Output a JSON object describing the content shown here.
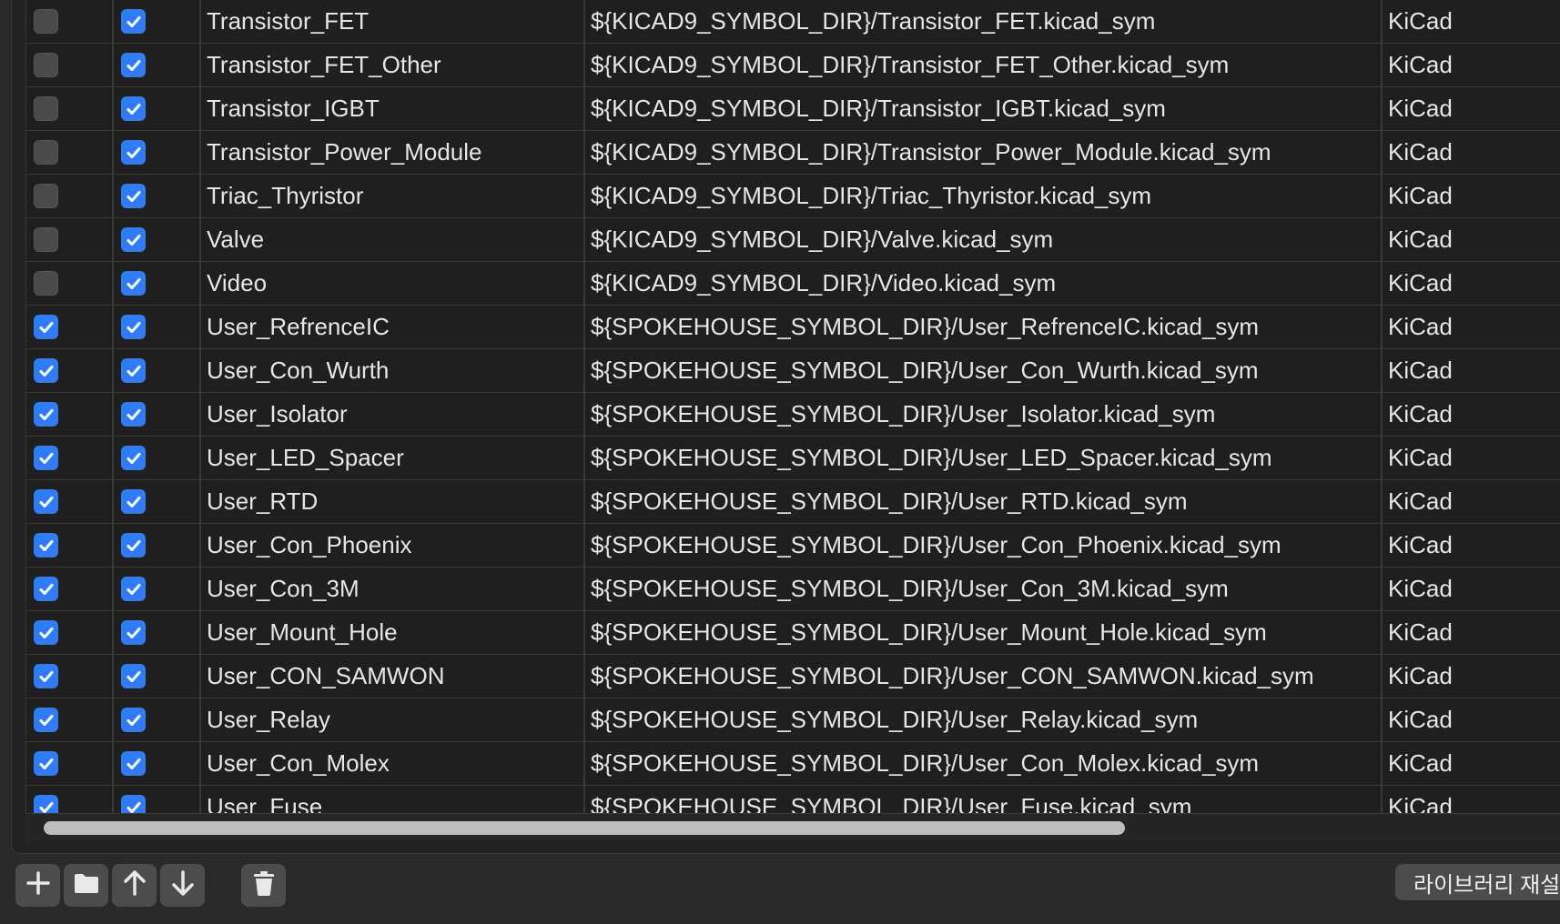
{
  "rows": [
    {
      "active": false,
      "visible": true,
      "nickname": "Transistor_FET",
      "path": "${KICAD9_SYMBOL_DIR}/Transistor_FET.kicad_sym",
      "type": "KiCad"
    },
    {
      "active": false,
      "visible": true,
      "nickname": "Transistor_FET_Other",
      "path": "${KICAD9_SYMBOL_DIR}/Transistor_FET_Other.kicad_sym",
      "type": "KiCad"
    },
    {
      "active": false,
      "visible": true,
      "nickname": "Transistor_IGBT",
      "path": "${KICAD9_SYMBOL_DIR}/Transistor_IGBT.kicad_sym",
      "type": "KiCad"
    },
    {
      "active": false,
      "visible": true,
      "nickname": "Transistor_Power_Module",
      "path": "${KICAD9_SYMBOL_DIR}/Transistor_Power_Module.kicad_sym",
      "type": "KiCad"
    },
    {
      "active": false,
      "visible": true,
      "nickname": "Triac_Thyristor",
      "path": "${KICAD9_SYMBOL_DIR}/Triac_Thyristor.kicad_sym",
      "type": "KiCad"
    },
    {
      "active": false,
      "visible": true,
      "nickname": "Valve",
      "path": "${KICAD9_SYMBOL_DIR}/Valve.kicad_sym",
      "type": "KiCad"
    },
    {
      "active": false,
      "visible": true,
      "nickname": "Video",
      "path": "${KICAD9_SYMBOL_DIR}/Video.kicad_sym",
      "type": "KiCad"
    },
    {
      "active": true,
      "visible": true,
      "nickname": "User_RefrenceIC",
      "path": "${SPOKEHOUSE_SYMBOL_DIR}/User_RefrenceIC.kicad_sym",
      "type": "KiCad"
    },
    {
      "active": true,
      "visible": true,
      "nickname": "User_Con_Wurth",
      "path": "${SPOKEHOUSE_SYMBOL_DIR}/User_Con_Wurth.kicad_sym",
      "type": "KiCad"
    },
    {
      "active": true,
      "visible": true,
      "nickname": "User_Isolator",
      "path": "${SPOKEHOUSE_SYMBOL_DIR}/User_Isolator.kicad_sym",
      "type": "KiCad"
    },
    {
      "active": true,
      "visible": true,
      "nickname": "User_LED_Spacer",
      "path": "${SPOKEHOUSE_SYMBOL_DIR}/User_LED_Spacer.kicad_sym",
      "type": "KiCad"
    },
    {
      "active": true,
      "visible": true,
      "nickname": "User_RTD",
      "path": "${SPOKEHOUSE_SYMBOL_DIR}/User_RTD.kicad_sym",
      "type": "KiCad"
    },
    {
      "active": true,
      "visible": true,
      "nickname": "User_Con_Phoenix",
      "path": "${SPOKEHOUSE_SYMBOL_DIR}/User_Con_Phoenix.kicad_sym",
      "type": "KiCad"
    },
    {
      "active": true,
      "visible": true,
      "nickname": "User_Con_3M",
      "path": "${SPOKEHOUSE_SYMBOL_DIR}/User_Con_3M.kicad_sym",
      "type": "KiCad"
    },
    {
      "active": true,
      "visible": true,
      "nickname": "User_Mount_Hole",
      "path": "${SPOKEHOUSE_SYMBOL_DIR}/User_Mount_Hole.kicad_sym",
      "type": "KiCad"
    },
    {
      "active": true,
      "visible": true,
      "nickname": "User_CON_SAMWON",
      "path": "${SPOKEHOUSE_SYMBOL_DIR}/User_CON_SAMWON.kicad_sym",
      "type": "KiCad"
    },
    {
      "active": true,
      "visible": true,
      "nickname": "User_Relay",
      "path": "${SPOKEHOUSE_SYMBOL_DIR}/User_Relay.kicad_sym",
      "type": "KiCad"
    },
    {
      "active": true,
      "visible": true,
      "nickname": "User_Con_Molex",
      "path": "${SPOKEHOUSE_SYMBOL_DIR}/User_Con_Molex.kicad_sym",
      "type": "KiCad"
    },
    {
      "active": true,
      "visible": true,
      "nickname": "User_Fuse",
      "path": "${SPOKEHOUSE_SYMBOL_DIR}/User_Fuse.kicad_sym",
      "type": "KiCad"
    }
  ],
  "toolbar": {
    "buttons": [
      {
        "name": "add-row-button",
        "icon": "plus-icon"
      },
      {
        "name": "browse-folder-button",
        "icon": "folder-icon"
      },
      {
        "name": "move-up-button",
        "icon": "arrow-up-icon"
      },
      {
        "name": "move-down-button",
        "icon": "arrow-down-icon"
      },
      {
        "name": "delete-button",
        "icon": "trash-icon"
      }
    ],
    "reset_label": "라이브러리 재설정"
  },
  "colors": {
    "accent": "#2f7cf6",
    "row_bg": "#1f1f1f",
    "grid_line": "#3a3a3a"
  }
}
